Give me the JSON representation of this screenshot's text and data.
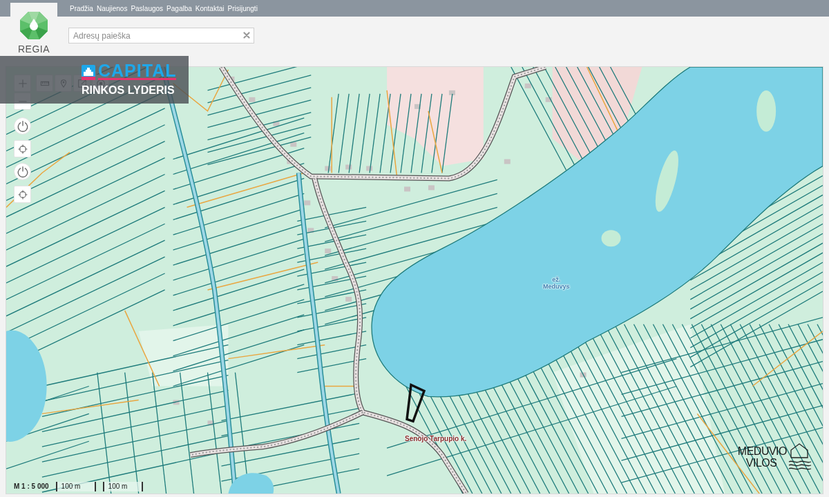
{
  "header": {
    "logo_text": "REGIA",
    "nav": [
      "Pradžia",
      "Naujienos",
      "Paslaugos",
      "Pagalba",
      "Kontaktai",
      "Prisijungti"
    ],
    "search": {
      "placeholder": "Adresų paieška"
    }
  },
  "banner": {
    "brand": "CAPITAL",
    "tagline": "RINKOS LYDERIS"
  },
  "map": {
    "labels": [
      {
        "kind": "lake",
        "lines": [
          "ež.",
          "Meduvys"
        ]
      },
      {
        "kind": "settlement",
        "lines": [
          "Senojo Tarpupio k."
        ]
      }
    ],
    "scale": {
      "ratio": "M 1 : 5 000",
      "bars": [
        "100 m",
        "100 m"
      ]
    },
    "project_logo": {
      "lines": [
        "MEDUVIO",
        "VILOS"
      ]
    }
  }
}
